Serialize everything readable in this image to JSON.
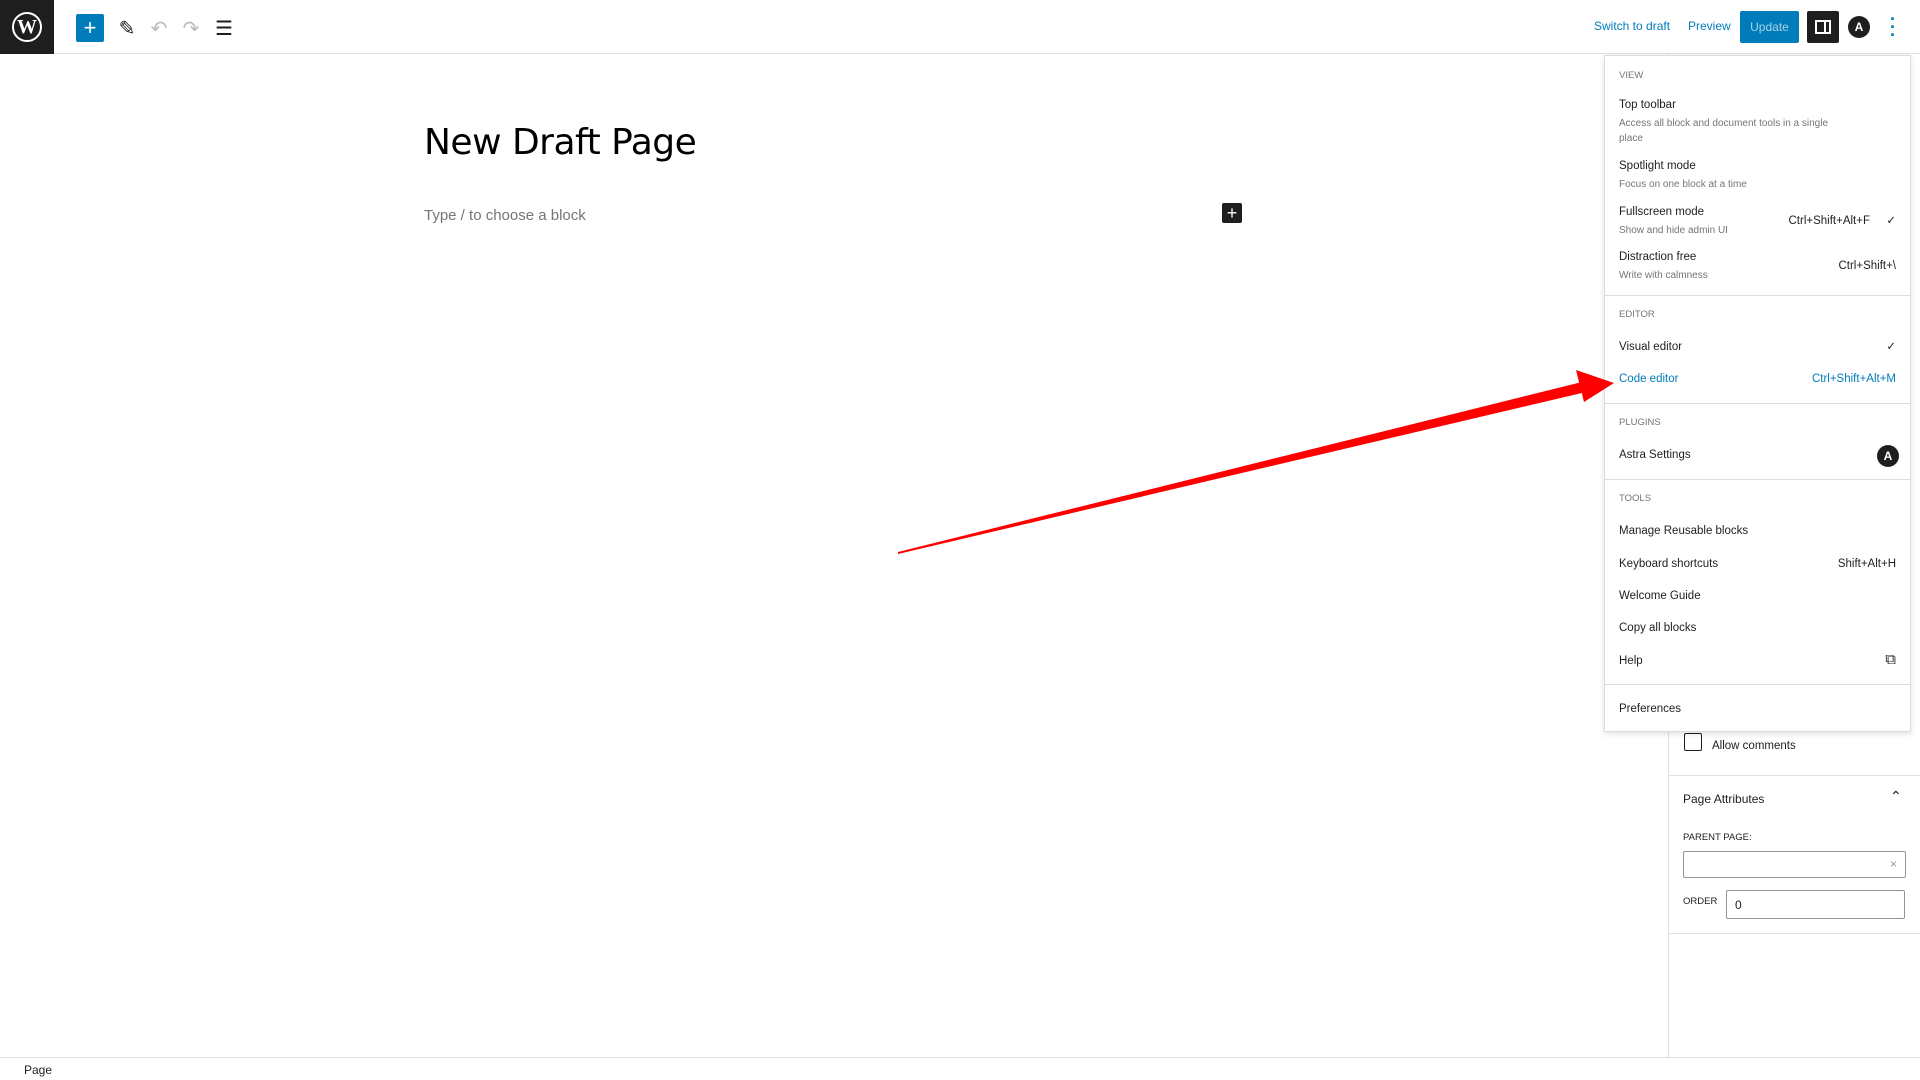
{
  "header": {
    "switch_to_draft": "Switch to draft",
    "preview": "Preview",
    "update": "Update",
    "wp_logo": "W",
    "astra_icon": "A",
    "add_block_icon": "+",
    "colors": {
      "accent": "#007cba",
      "dark": "#1e1e1e"
    }
  },
  "editor": {
    "title": "New Draft Page",
    "placeholder": "Type / to choose a block"
  },
  "menu": {
    "view_heading": "VIEW",
    "view_items": [
      {
        "label": "Top toolbar",
        "desc": "Access all block and document tools in a single place",
        "shortcut": ""
      },
      {
        "label": "Spotlight mode",
        "desc": "Focus on one block at a time",
        "shortcut": ""
      },
      {
        "label": "Fullscreen mode",
        "desc": "Show and hide admin UI",
        "shortcut": "Ctrl+Shift+Alt+F",
        "checked": true
      },
      {
        "label": "Distraction free",
        "desc": "Write with calmness",
        "shortcut": "Ctrl+Shift+\\"
      }
    ],
    "editor_heading": "EDITOR",
    "visual_editor": "Visual editor",
    "code_editor": "Code editor",
    "code_editor_shortcut": "Ctrl+Shift+Alt+M",
    "plugins_heading": "PLUGINS",
    "astra_settings": "Astra Settings",
    "tools_heading": "TOOLS",
    "tools": [
      {
        "label": "Manage Reusable blocks",
        "shortcut": ""
      },
      {
        "label": "Keyboard shortcuts",
        "shortcut": "Shift+Alt+H"
      },
      {
        "label": "Welcome Guide",
        "shortcut": ""
      },
      {
        "label": "Copy all blocks",
        "shortcut": ""
      },
      {
        "label": "Help",
        "shortcut": ""
      }
    ],
    "preferences": "Preferences",
    "check": "✓"
  },
  "sidebar": {
    "allow_comments": "Allow comments",
    "page_attributes": "Page Attributes",
    "parent_page_label": "PARENT PAGE:",
    "parent_page_value": "",
    "order_label": "ORDER",
    "order_value": "0"
  },
  "footer": {
    "breadcrumb": "Page"
  }
}
